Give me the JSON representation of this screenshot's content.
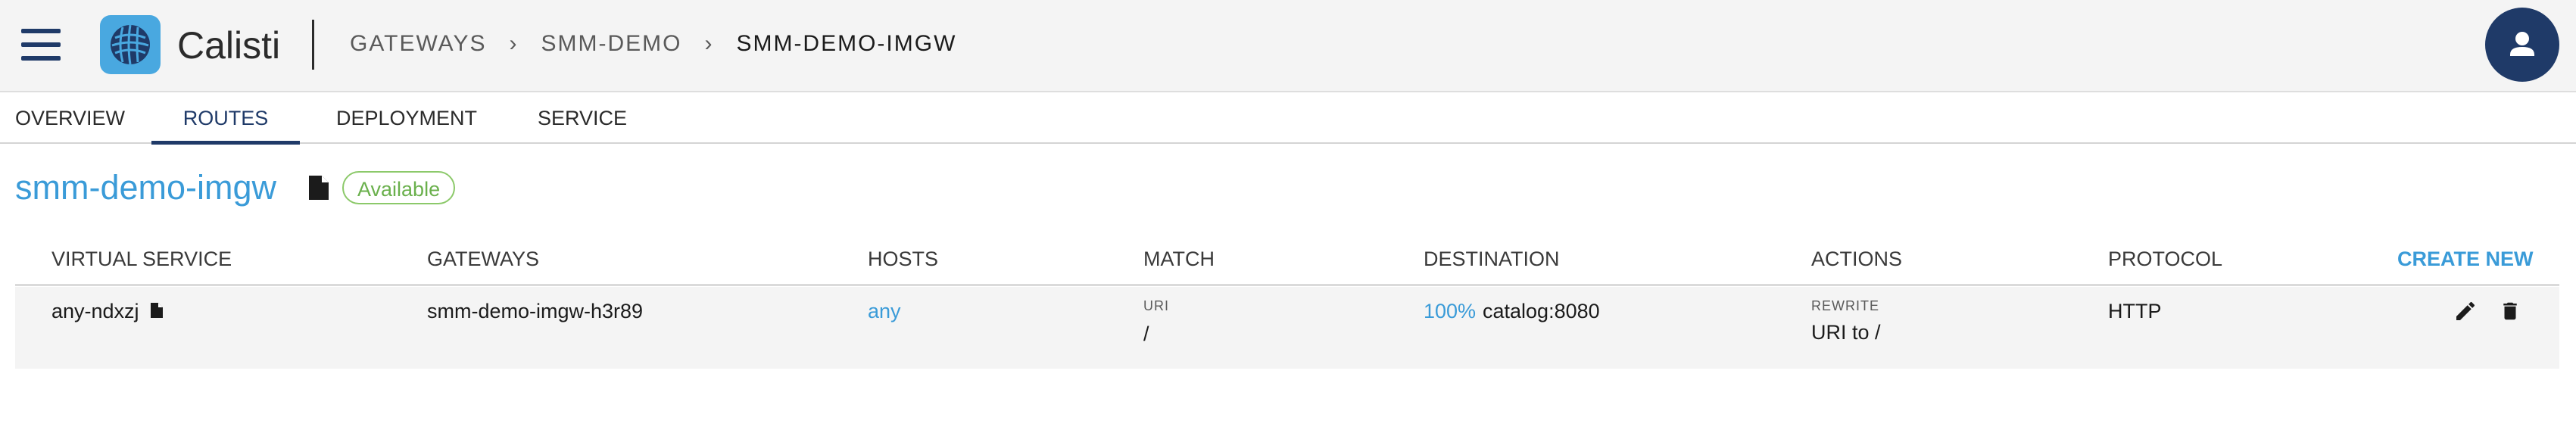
{
  "app": {
    "title": "Calisti"
  },
  "breadcrumb": {
    "items": [
      "GATEWAYS",
      "SMM-DEMO",
      "SMM-DEMO-IMGW"
    ],
    "separator": "›"
  },
  "tabs": [
    {
      "label": "OVERVIEW"
    },
    {
      "label": "ROUTES",
      "active": true
    },
    {
      "label": "DEPLOYMENT"
    },
    {
      "label": "SERVICE"
    }
  ],
  "resource": {
    "name": "smm-demo-imgw",
    "status": "Available"
  },
  "table": {
    "headers": {
      "virtual_service": "VIRTUAL SERVICE",
      "gateways": "GATEWAYS",
      "hosts": "HOSTS",
      "match": "MATCH",
      "destination": "DESTINATION",
      "actions": "ACTIONS",
      "protocol": "PROTOCOL"
    },
    "create_new_label": "CREATE NEW",
    "rows": [
      {
        "virtual_service": "any-ndxzj",
        "gateways": "smm-demo-imgw-h3r89",
        "hosts": "any",
        "match_label": "URI",
        "match_value": "/",
        "destination_weight": "100%",
        "destination_target": "catalog:8080",
        "action_label": "REWRITE",
        "action_value": "URI to /",
        "protocol": "HTTP"
      }
    ]
  },
  "icons": {
    "menu": "hamburger-menu-icon",
    "logo": "calisti-logo-icon",
    "user": "user-icon",
    "document": "document-icon",
    "edit": "pencil-icon",
    "delete": "trash-icon"
  },
  "colors": {
    "primary": "#1f3a68",
    "accent": "#3a9bd8",
    "status_available": "#6ab04c",
    "header_bg": "#f4f4f4"
  }
}
